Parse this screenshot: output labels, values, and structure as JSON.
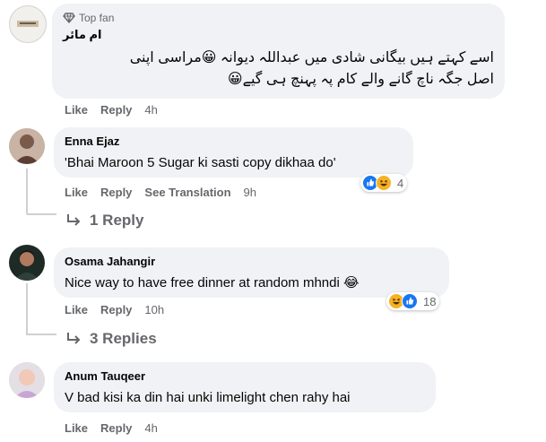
{
  "comments": [
    {
      "badge": "Top fan",
      "author": "ام مائر",
      "text_lines": [
        "اسے کہتے ہیں بیگانی شادی میں عبداللہ دیوانہ 😀مراسی اپنی",
        "اصل جگہ ناچ گانے والے کام پہ پہنچ ہی گیے😀"
      ],
      "like": "Like",
      "reply": "Reply",
      "time": "4h"
    },
    {
      "author": "Enna Ejaz",
      "text": "'Bhai Maroon 5 Sugar ki sasti copy dikhaa do'",
      "like": "Like",
      "reply": "Reply",
      "see_translation": "See Translation",
      "time": "9h",
      "reactions": [
        "like",
        "haha"
      ],
      "reaction_count": "4",
      "replies_label": "1 Reply"
    },
    {
      "author": "Osama Jahangir",
      "text": "Nice way to have free dinner at random mhndi 😂",
      "like": "Like",
      "reply": "Reply",
      "time": "10h",
      "reactions": [
        "haha",
        "like"
      ],
      "reaction_count": "18",
      "replies_label": "3 Replies"
    },
    {
      "author": "Anum Tauqeer",
      "text": "V bad kisi ka din hai unki limelight chen rahy hai",
      "like": "Like",
      "reply": "Reply",
      "time": "4h"
    }
  ],
  "colors": {
    "bubble": "#f0f2f5",
    "meta": "#65676b",
    "like_blue": "#1877f2",
    "haha_yellow": "#f7b125"
  }
}
